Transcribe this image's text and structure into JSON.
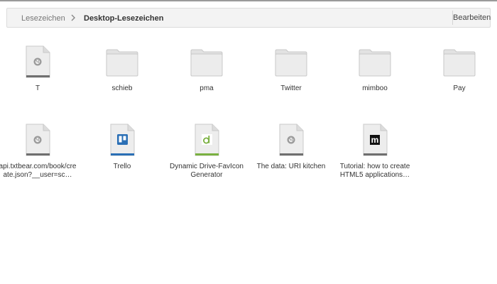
{
  "toolbar": {
    "breadcrumb_root": "Lesezeichen",
    "breadcrumb_current": "Desktop-Lesezeichen",
    "edit_label": "Bearbeiten"
  },
  "items": [
    {
      "label": "T",
      "icon": "globe-page-icon"
    },
    {
      "label": "schieb",
      "icon": "folder-icon"
    },
    {
      "label": "pma",
      "icon": "folder-icon"
    },
    {
      "label": "Twitter",
      "icon": "folder-icon"
    },
    {
      "label": "mimboo",
      "icon": "folder-icon"
    },
    {
      "label": "Pay",
      "icon": "folder-icon"
    },
    {
      "label": "api.txtbear.com/book/create.json?__user=sc…",
      "icon": "globe-page-icon"
    },
    {
      "label": "Trello",
      "icon": "trello-page-icon"
    },
    {
      "label": "Dynamic Drive-FavIcon Generator",
      "icon": "dynamicdrive-page-icon"
    },
    {
      "label": "The data: URI kitchen",
      "icon": "globe-page-icon"
    },
    {
      "label": "Tutorial: how to create HTML5 applications…",
      "icon": "m-page-icon"
    }
  ],
  "colors": {
    "folder": "#ececec",
    "page_gray_bar": "#6f6f6f",
    "trello_blue": "#2a6fb5",
    "dynamicdrive_green": "#7ab040"
  }
}
